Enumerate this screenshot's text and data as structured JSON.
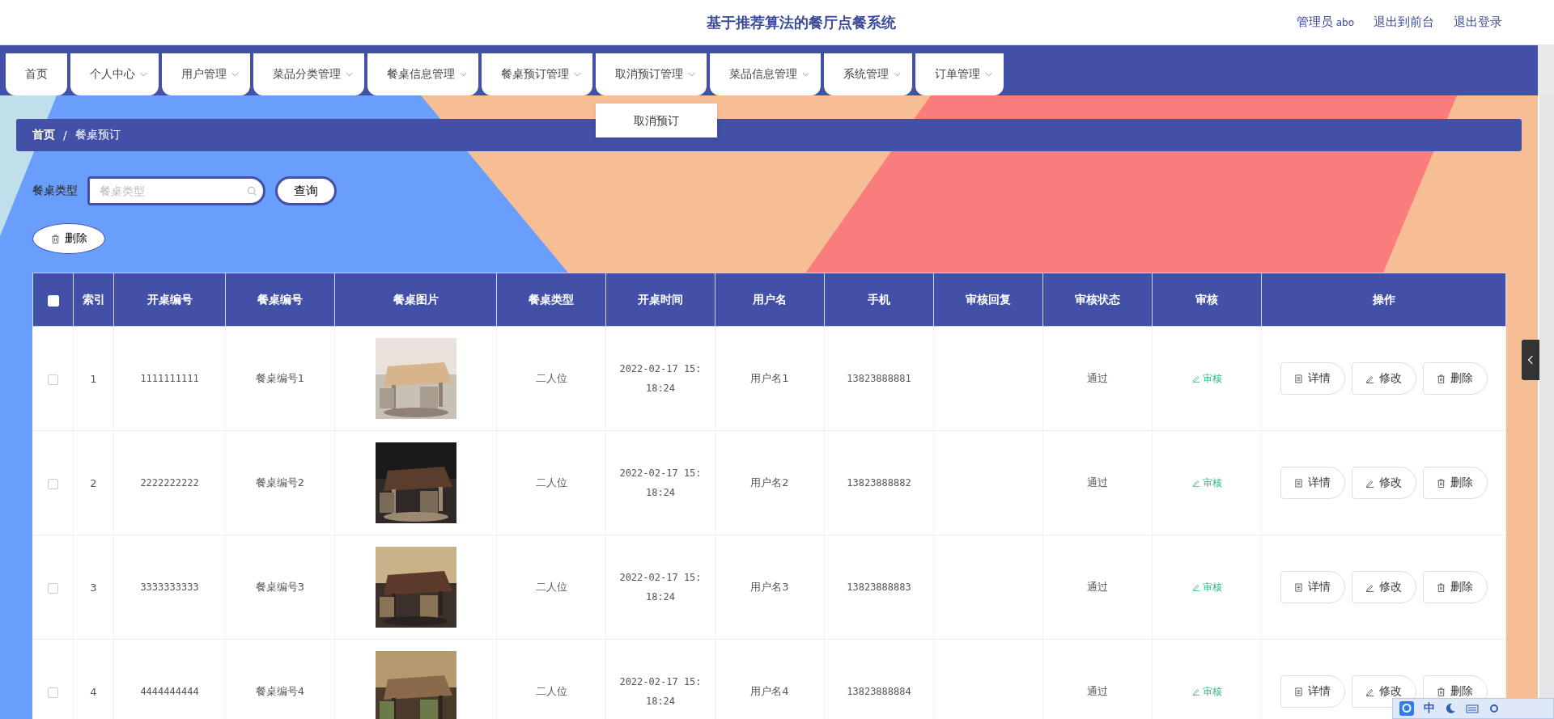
{
  "header": {
    "title": "基于推荐算法的餐厅点餐系统",
    "role": "管理员",
    "username": "abo",
    "links": [
      "退出到前台",
      "退出登录"
    ]
  },
  "nav": {
    "tabs": [
      {
        "label": "首页",
        "kind": "link"
      },
      {
        "label": "个人中心",
        "kind": "menu"
      },
      {
        "label": "用户管理",
        "kind": "menu"
      },
      {
        "label": "菜品分类管理",
        "kind": "menu"
      },
      {
        "label": "餐桌信息管理",
        "kind": "menu"
      },
      {
        "label": "餐桌预订管理",
        "kind": "menu"
      },
      {
        "label": "取消预订管理",
        "kind": "menu",
        "dropdown": [
          "取消预订"
        ]
      },
      {
        "label": "菜品信息管理",
        "kind": "menu"
      },
      {
        "label": "系统管理",
        "kind": "menu"
      },
      {
        "label": "订单管理",
        "kind": "menu"
      }
    ]
  },
  "breadcrumb": {
    "items": [
      "首页",
      "餐桌预订"
    ],
    "separator": "/"
  },
  "search": {
    "label": "餐桌类型",
    "placeholder": "餐桌类型",
    "button": "查询"
  },
  "toolbar": {
    "delete_button": "删除"
  },
  "table": {
    "select_all": false,
    "columns": [
      "索引",
      "开桌编号",
      "餐桌编号",
      "餐桌图片",
      "餐桌类型",
      "开桌时间",
      "用户名",
      "手机",
      "审核回复",
      "审核状态",
      "审核",
      "操作"
    ],
    "rows": [
      {
        "checked": false,
        "index": "1",
        "code": "1111111111",
        "table_no": "餐桌编号1",
        "picture": {
          "kind": "picture"
        },
        "type": "二人位",
        "time": "2022-02-17 15:18:24",
        "user": "用户名1",
        "phone": "13823888881",
        "status": "通过",
        "review": "审核",
        "actions": [
          "详情",
          "修改",
          "删除"
        ]
      },
      {
        "checked": false,
        "index": "2",
        "code": "2222222222",
        "table_no": "餐桌编号2",
        "picture": {
          "kind": "picture"
        },
        "type": "二人位",
        "time": "2022-02-17 15:18:24",
        "user": "用户名2",
        "phone": "13823888882",
        "status": "通过",
        "review": "审核",
        "actions": [
          "详情",
          "修改",
          "删除"
        ]
      },
      {
        "checked": false,
        "index": "3",
        "code": "3333333333",
        "table_no": "餐桌编号3",
        "picture": {
          "kind": "picture"
        },
        "type": "二人位",
        "time": "2022-02-17 15:18:24",
        "user": "用户名3",
        "phone": "13823888883",
        "status": "通过",
        "review": "审核",
        "actions": [
          "详情",
          "修改",
          "删除"
        ]
      },
      {
        "checked": false,
        "index": "4",
        "code": "4444444444",
        "table_no": "餐桌编号4",
        "picture": {
          "kind": "picture"
        },
        "type": "二人位",
        "time": "2022-02-17 15:18:24",
        "user": "用户名4",
        "phone": "13823888884",
        "status": "通过",
        "review": "审核",
        "actions": [
          "详情",
          "修改",
          "删除"
        ]
      }
    ]
  },
  "ime_bar": {
    "mode": "中"
  }
}
